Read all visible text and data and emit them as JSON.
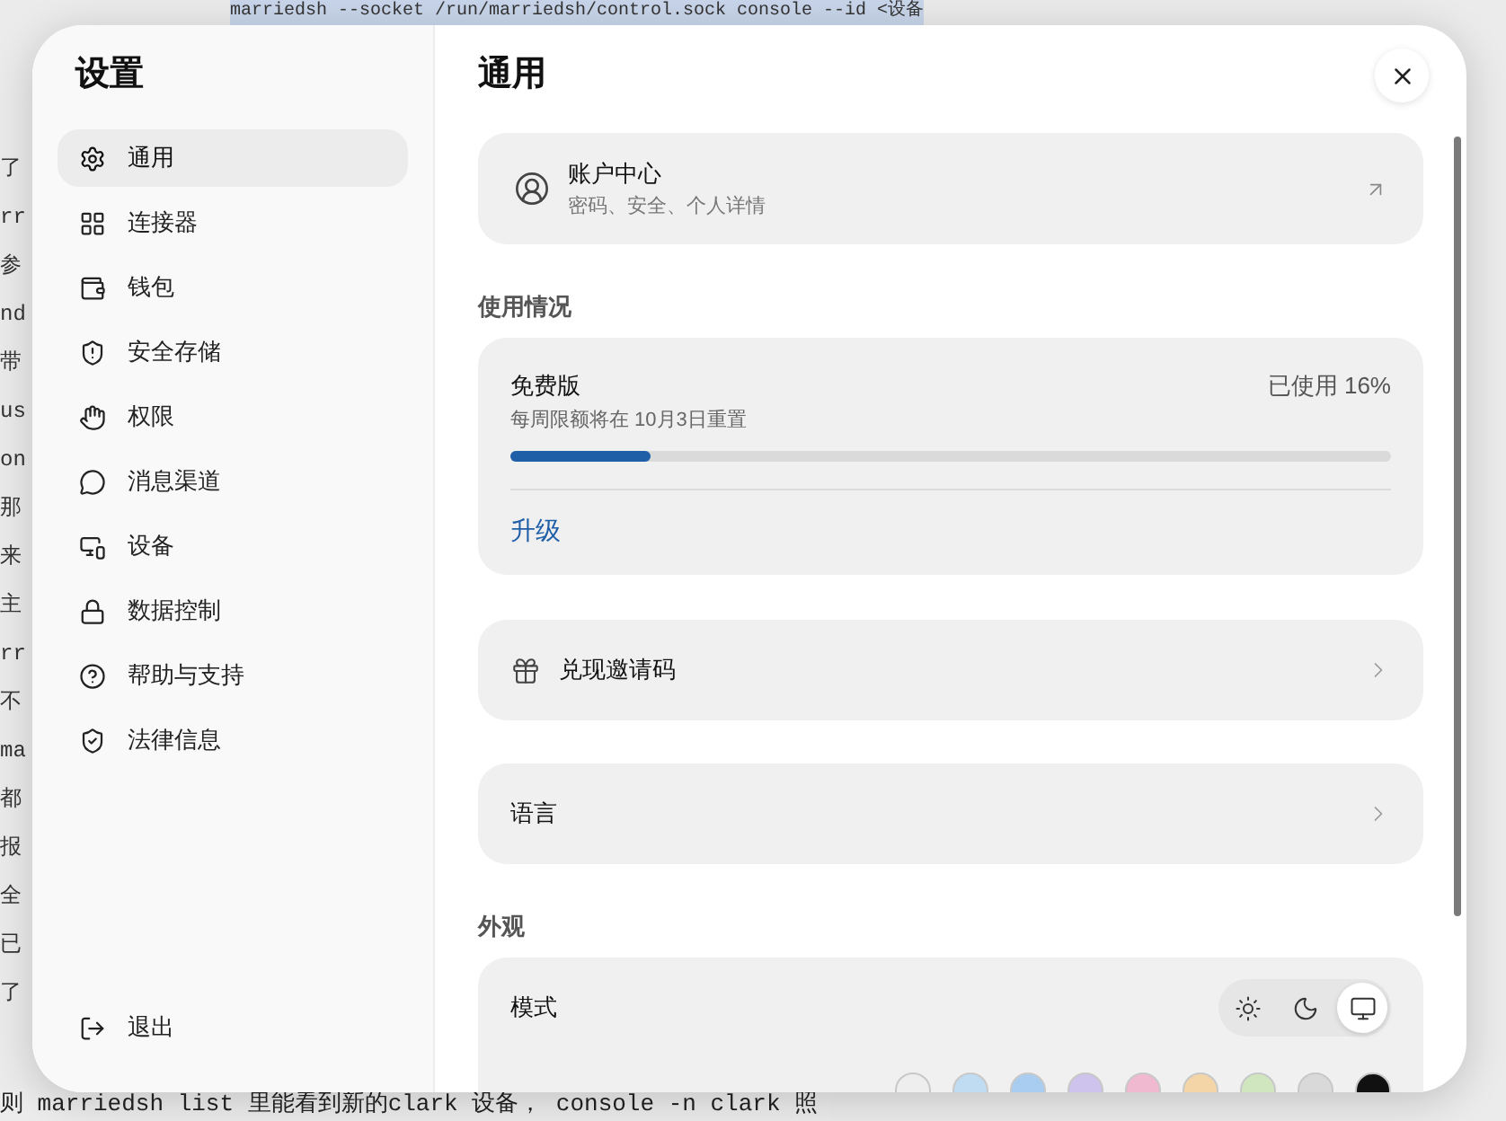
{
  "background_document": {
    "top_line": "marriedsh --socket /run/marriedsh/control.sock console --id <设备",
    "left_fragments": [
      {
        "text": "了"
      },
      {
        "text": "rr"
      },
      {
        "text": "参"
      },
      {
        "text": "nd"
      },
      {
        "text": "带"
      },
      {
        "text": "us"
      },
      {
        "text": "on"
      },
      {
        "text": "那"
      },
      {
        "text": "来"
      },
      {
        "text": "主"
      },
      {
        "text": "rr"
      },
      {
        "text": "不"
      },
      {
        "text": "ma"
      },
      {
        "text": "都"
      },
      {
        "text": "报"
      },
      {
        "text": "全"
      },
      {
        "text": "已"
      },
      {
        "text": "了"
      }
    ],
    "bottom_line": "则 marriedsh list 里能看到新的clark 设备， console -n clark 照"
  },
  "sidebar": {
    "title": "设置",
    "items": [
      {
        "label": "通用",
        "selected": true
      },
      {
        "label": "连接器",
        "selected": false
      },
      {
        "label": "钱包",
        "selected": false
      },
      {
        "label": "安全存储",
        "selected": false
      },
      {
        "label": "权限",
        "selected": false
      },
      {
        "label": "消息渠道",
        "selected": false
      },
      {
        "label": "设备",
        "selected": false
      },
      {
        "label": "数据控制",
        "selected": false
      },
      {
        "label": "帮助与支持",
        "selected": false
      },
      {
        "label": "法律信息",
        "selected": false
      }
    ],
    "logout": "退出"
  },
  "main": {
    "title": "通用",
    "account": {
      "title": "账户中心",
      "subtitle": "密码、安全、个人详情"
    },
    "usage_heading": "使用情况",
    "usage": {
      "plan": "免费版",
      "reset": "每周限额将在 10月3日重置",
      "used": "已使用 16%",
      "level": 0.16,
      "upgrade": "升级"
    },
    "rows": [
      {
        "label": "兑现邀请码",
        "kind": "gift"
      },
      {
        "label": "语言",
        "kind": "plain"
      }
    ],
    "appearance_heading": "外观",
    "mode": {
      "label": "模式",
      "options": [
        {
          "kind": "light",
          "selected": false
        },
        {
          "kind": "dark",
          "selected": false
        },
        {
          "kind": "system",
          "selected": true
        }
      ]
    },
    "accent_colors": [
      {
        "color": "#eeeeee"
      },
      {
        "color": "#bfdcf3"
      },
      {
        "color": "#a8cdf0"
      },
      {
        "color": "#cdc3ec"
      },
      {
        "color": "#f0b9cf"
      },
      {
        "color": "#f3d5a8"
      },
      {
        "color": "#cfe6bf"
      },
      {
        "color": "#d9d9d9"
      },
      {
        "color": "#111111"
      }
    ]
  }
}
